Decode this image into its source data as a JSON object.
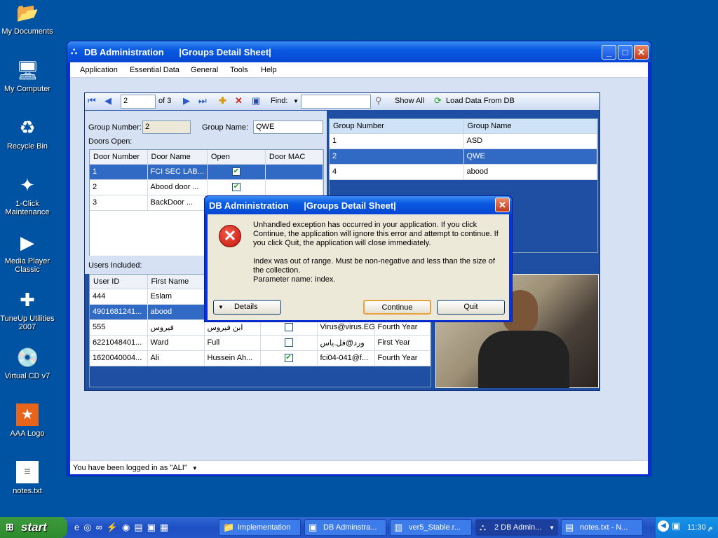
{
  "desktop": {
    "icons": [
      {
        "label": "My Documents",
        "icon": "folder-icon"
      },
      {
        "label": "My Computer",
        "icon": "computer-icon"
      },
      {
        "label": "Recycle Bin",
        "icon": "recycle-bin-icon"
      },
      {
        "label": "1-Click Maintenance",
        "icon": "maintenance-icon"
      },
      {
        "label": "Media Player Classic",
        "icon": "media-player-icon"
      },
      {
        "label": "TuneUp Utilities 2007",
        "icon": "tuneup-icon"
      },
      {
        "label": "Virtual CD v7",
        "icon": "virtual-cd-icon"
      },
      {
        "label": "AAA Logo",
        "icon": "logo-icon"
      },
      {
        "label": "notes.txt",
        "icon": "text-file-icon"
      }
    ]
  },
  "main_window": {
    "title": "DB Administration      |Groups Detail Sheet|",
    "menu": [
      "Application",
      "Essential Data",
      "General",
      "Tools",
      "Help"
    ],
    "toolbar": {
      "position": "2",
      "of_label": "of 3",
      "find_label": "Find:",
      "find_value": "",
      "show_all": "Show All",
      "load_data": "Load Data From DB"
    },
    "form": {
      "group_number_label": "Group Number:",
      "group_number_value": "2",
      "group_name_label": "Group Name:",
      "group_name_value": "QWE",
      "doors_open_label": "Doors Open:",
      "users_included_label": "Users Included:"
    },
    "doors_grid": {
      "columns": [
        "Door Number",
        "Door Name",
        "Open",
        "Door MAC"
      ],
      "rows": [
        {
          "number": "1",
          "name": "FCI SEC LAB...",
          "open": true,
          "mac": ""
        },
        {
          "number": "2",
          "name": "Abood door ...",
          "open": true,
          "mac": ""
        },
        {
          "number": "3",
          "name": "BackDoor ...",
          "open": true,
          "mac": ""
        }
      ]
    },
    "groups_grid": {
      "columns": [
        "Group Number",
        "Group Name"
      ],
      "rows": [
        {
          "number": "1",
          "name": "ASD"
        },
        {
          "number": "2",
          "name": "QWE"
        },
        {
          "number": "4",
          "name": "abood"
        }
      ]
    },
    "users_grid": {
      "columns": [
        "User ID",
        "First Name"
      ],
      "rows": [
        {
          "id": "444",
          "first": "Eslam",
          "last": "",
          "checked": false,
          "email": "",
          "year": ""
        },
        {
          "id": "4901681241...",
          "first": "abood",
          "last": "",
          "checked": false,
          "email": "",
          "year": ""
        },
        {
          "id": "555",
          "first": "فيروس",
          "last": "ابن فيروس",
          "checked": false,
          "email": "Virus@virus.EG",
          "year": "Fourth Year"
        },
        {
          "id": "6221048401...",
          "first": "Ward",
          "last": "Full",
          "checked": false,
          "email": "ورد@فل.ياس",
          "year": "First Year"
        },
        {
          "id": "1620040004...",
          "first": "Ali",
          "last": "Hussein Ah...",
          "checked": true,
          "email": "fci04-041@f...",
          "year": "Fourth Year"
        }
      ]
    },
    "status": "You have been logged in as \"ALI\""
  },
  "dialog": {
    "title": "DB Administration      |Groups Detail Sheet|",
    "message_1": "Unhandled exception has occurred in your application. If you click Continue, the application will ignore this error and attempt to continue. If you click Quit, the application will close immediately.",
    "message_2": "Index was out of range. Must be non-negative and less than the size of the collection.",
    "message_3": "Parameter name: index.",
    "details_button": "Details",
    "continue_button": "Continue",
    "quit_button": "Quit"
  },
  "taskbar": {
    "start": "start",
    "tasks": [
      "Implementation",
      "DB Adminstra...",
      "ver5_Stable.r...",
      "2 DB Admin...",
      "notes.txt - N..."
    ],
    "clock": "11:30 م"
  }
}
